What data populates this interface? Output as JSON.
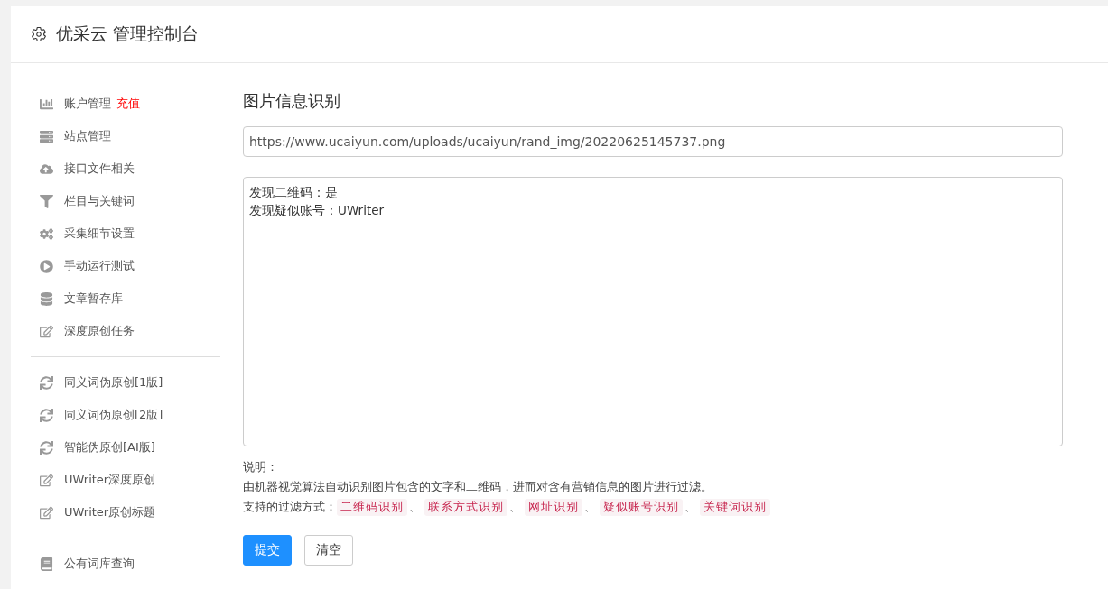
{
  "header": {
    "title": "优采云 管理控制台"
  },
  "sidebar": {
    "groups": [
      {
        "items": [
          {
            "label": "账户管理",
            "badge": "充值"
          },
          {
            "label": "站点管理"
          },
          {
            "label": "接口文件相关"
          },
          {
            "label": "栏目与关键词"
          },
          {
            "label": "采集细节设置"
          },
          {
            "label": "手动运行测试"
          },
          {
            "label": "文章暂存库"
          },
          {
            "label": "深度原创任务"
          }
        ]
      },
      {
        "items": [
          {
            "label": "同义词伪原创[1版]"
          },
          {
            "label": "同义词伪原创[2版]"
          },
          {
            "label": "智能伪原创[AI版]"
          },
          {
            "label": "UWriter深度原创"
          },
          {
            "label": "UWriter原创标题"
          }
        ]
      },
      {
        "items": [
          {
            "label": "公有词库查询"
          }
        ]
      }
    ]
  },
  "main": {
    "title": "图片信息识别",
    "url_field": {
      "value": "https://www.ucaiyun.com/uploads/ucaiyun/rand_img/20220625145737.png"
    },
    "result_field": {
      "lines": [
        "发现二维码：是",
        "发现疑似账号：UWriter"
      ]
    },
    "note_label": "说明：",
    "note_text": "由机器视觉算法自动识别图片包含的文字和二维码，进而对含有营销信息的图片进行过滤。",
    "filters_label": "支持的过滤方式：",
    "filter_separator": "、",
    "filters": [
      "二维码识别",
      "联系方式识别",
      "网址识别",
      "疑似账号识别",
      "关键词识别"
    ],
    "buttons": [
      {
        "label": "提交",
        "kind": "primary"
      },
      {
        "label": "清空",
        "kind": "default"
      }
    ]
  }
}
